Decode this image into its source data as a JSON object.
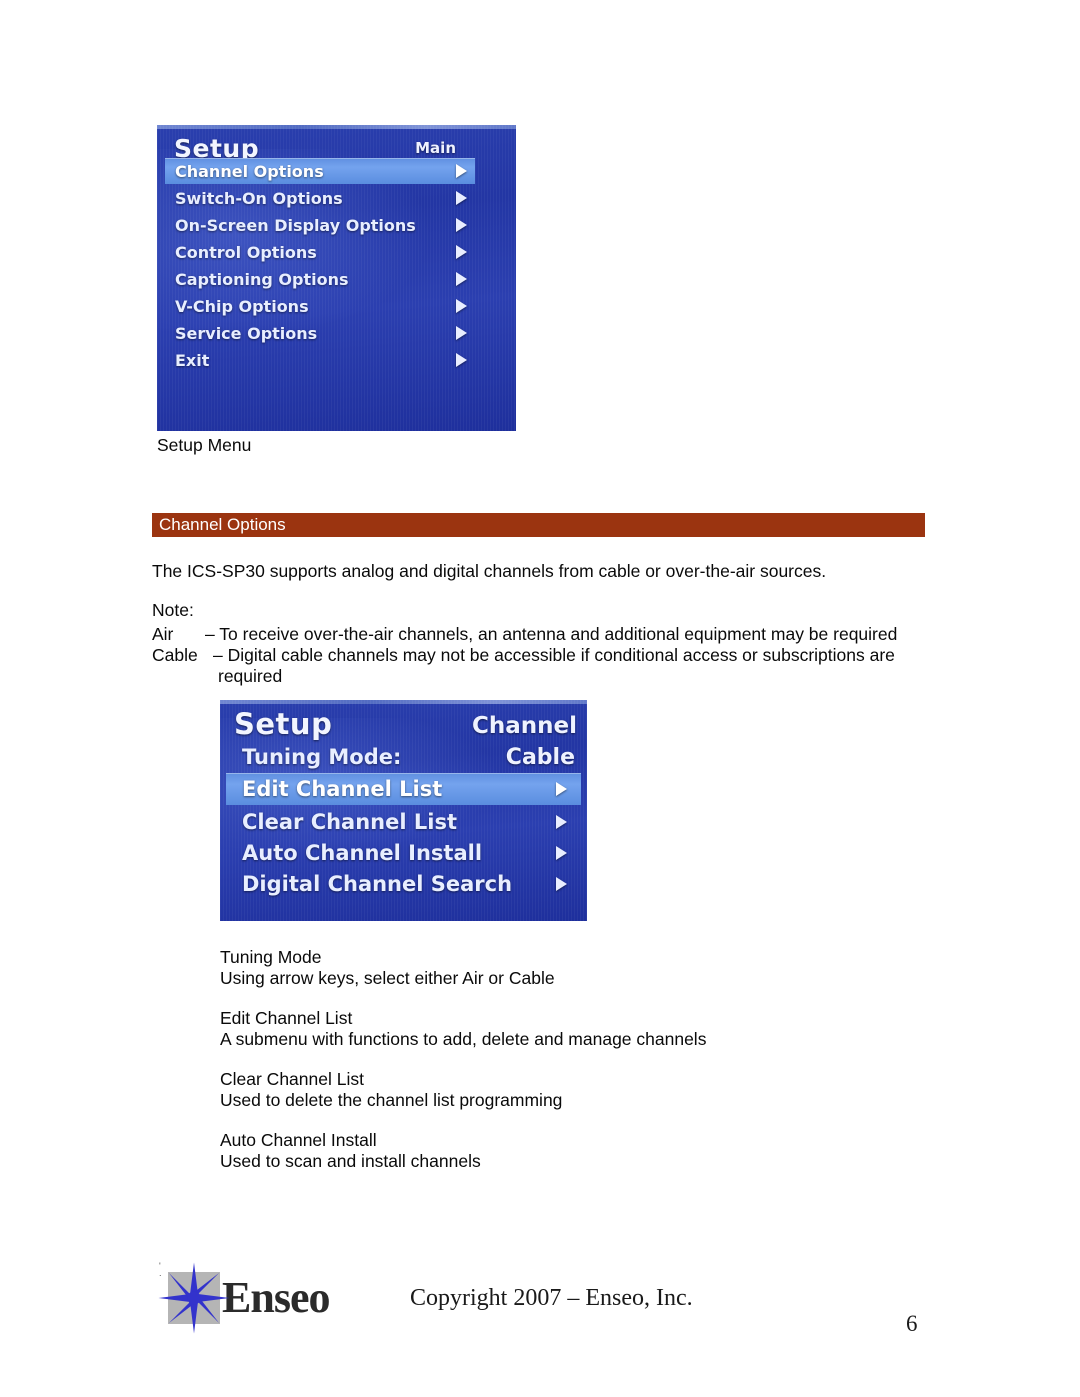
{
  "page": {
    "number": "6",
    "background_color": "#ffffff",
    "text_color": "#0a0a0a"
  },
  "setup_menu_screenshot": {
    "caption": "Setup Menu",
    "osd_title": "Setup",
    "osd_corner_label": "Main",
    "background_color": "#2336a4",
    "highlight_color": "#74a3ee",
    "items": [
      {
        "label": "Channel Options",
        "arrow_icon": "triangle-right-icon",
        "selected": true
      },
      {
        "label": "Switch-On Options",
        "arrow_icon": "triangle-right-icon",
        "selected": false
      },
      {
        "label": "On-Screen Display Options",
        "arrow_icon": "triangle-right-icon",
        "selected": false
      },
      {
        "label": "Control Options",
        "arrow_icon": "triangle-right-icon",
        "selected": false
      },
      {
        "label": "Captioning Options",
        "arrow_icon": "triangle-right-icon",
        "selected": false
      },
      {
        "label": "V-Chip Options",
        "arrow_icon": "triangle-right-icon",
        "selected": false
      },
      {
        "label": "Service Options",
        "arrow_icon": "triangle-right-icon",
        "selected": false
      },
      {
        "label": "Exit",
        "arrow_icon": "triangle-right-icon",
        "selected": false
      }
    ]
  },
  "section": {
    "heading": "Channel Options",
    "bar_color": "#9b3410"
  },
  "body": {
    "intro": "The ICS-SP30 supports analog and digital channels from cable or over-the-air sources.",
    "note_label": "Note:",
    "note_air_term": "Air",
    "note_air_text": "– To receive over-the-air channels, an antenna and additional equipment may be required",
    "note_cable_term": "Cable",
    "note_cable_text": "– Digital cable channels may not be accessible if conditional access or subscriptions are",
    "note_cable_cont": "required"
  },
  "channel_menu_screenshot": {
    "osd_title": "Setup",
    "osd_corner_label": "Channel",
    "background_color": "#2336a4",
    "highlight_color": "#74a3ee",
    "items": [
      {
        "label": "Tuning Mode:",
        "value": "Cable",
        "arrow_icon": "",
        "selected": false
      },
      {
        "label": "Edit Channel List",
        "value": "",
        "arrow_icon": "triangle-right-icon",
        "selected": true
      },
      {
        "label": "Clear Channel List",
        "value": "",
        "arrow_icon": "triangle-right-icon",
        "selected": false
      },
      {
        "label": "Auto Channel Install",
        "value": "",
        "arrow_icon": "triangle-right-icon",
        "selected": false
      },
      {
        "label": "Digital Channel Search",
        "value": "",
        "arrow_icon": "triangle-right-icon",
        "selected": false
      }
    ]
  },
  "descriptions": [
    {
      "term": "Tuning Mode",
      "text": "Using arrow keys, select either Air or Cable"
    },
    {
      "term": "Edit Channel List",
      "text": "A submenu with functions to add, delete and manage channels"
    },
    {
      "term": "Clear Channel List",
      "text": "Used to delete the channel list programming"
    },
    {
      "term": "Auto Channel Install",
      "text": "Used to scan and install channels"
    }
  ],
  "footer": {
    "copyright": "Copyright 2007 – Enseo, Inc.",
    "logo_wordmark": "Enseo",
    "logo_star_icon": "enseo-star-icon",
    "logo_square_color": "#b5b5b5",
    "logo_star_color": "#3333cc",
    "logo_tick_marks": "'\n."
  }
}
